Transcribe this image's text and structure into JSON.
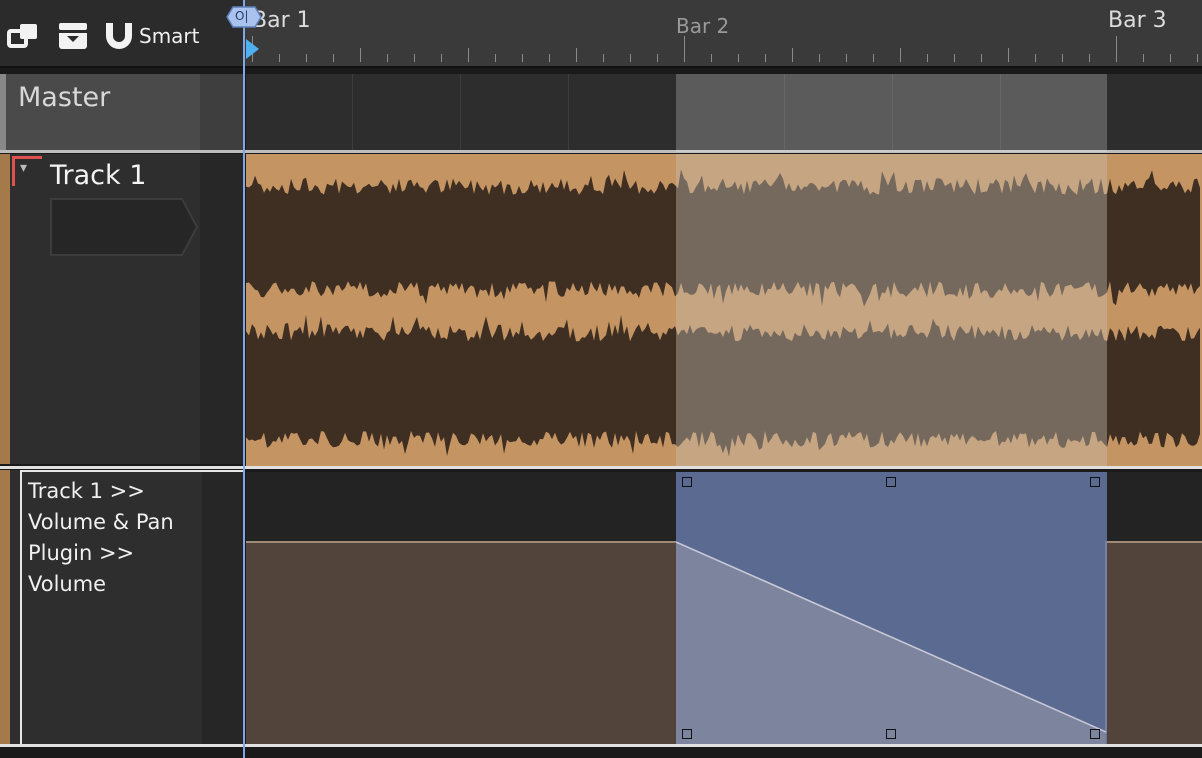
{
  "toolbar": {
    "smart_label": "Smart",
    "buttons": [
      {
        "name": "window-layout-icon"
      },
      {
        "name": "collapse-tray-icon"
      },
      {
        "name": "magnet-snap-icon"
      }
    ]
  },
  "ruler": {
    "bars": [
      "Bar 1",
      "Bar 2",
      "Bar 3"
    ]
  },
  "tracks": {
    "master": {
      "title": "Master"
    },
    "track1": {
      "title": "Track 1",
      "expand_glyph": "▾"
    },
    "automation": {
      "lines": [
        "Track 1 >>",
        "Volume & Pan",
        "Plugin >>",
        "Volume"
      ]
    }
  },
  "playhead": {
    "marker_label": "O|"
  },
  "colors": {
    "track_color": "#a57a4a",
    "waveform_light": "#c59463",
    "waveform_dark": "#3e2f22",
    "selection": "#6a7fb0",
    "automation_fill": "#52443a",
    "playhead": "#7fa6e6"
  }
}
